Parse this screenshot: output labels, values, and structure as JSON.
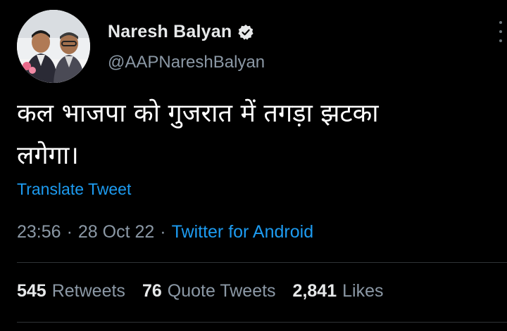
{
  "tweet": {
    "author": {
      "display_name": "Naresh Balyan",
      "handle": "@AAPNareshBalyan",
      "verified": true,
      "avatar_icon": "profile-photo"
    },
    "text_line_1": "कल भाजपा को गुजरात में तगड़ा झटका",
    "text_line_2": "लगेगा।",
    "translate_label": "Translate Tweet",
    "time": "23:56",
    "date": "28 Oct 22",
    "separator": "·",
    "source": "Twitter for Android",
    "stats": {
      "retweets_count": "545",
      "retweets_label": "Retweets",
      "quotes_count": "76",
      "quotes_label": "Quote Tweets",
      "likes_count": "2,841",
      "likes_label": "Likes"
    }
  },
  "colors": {
    "background": "#000000",
    "text_primary": "#e7e9ea",
    "text_secondary": "#8b98a5",
    "link": "#1d9bf0",
    "divider": "#2f3336"
  }
}
